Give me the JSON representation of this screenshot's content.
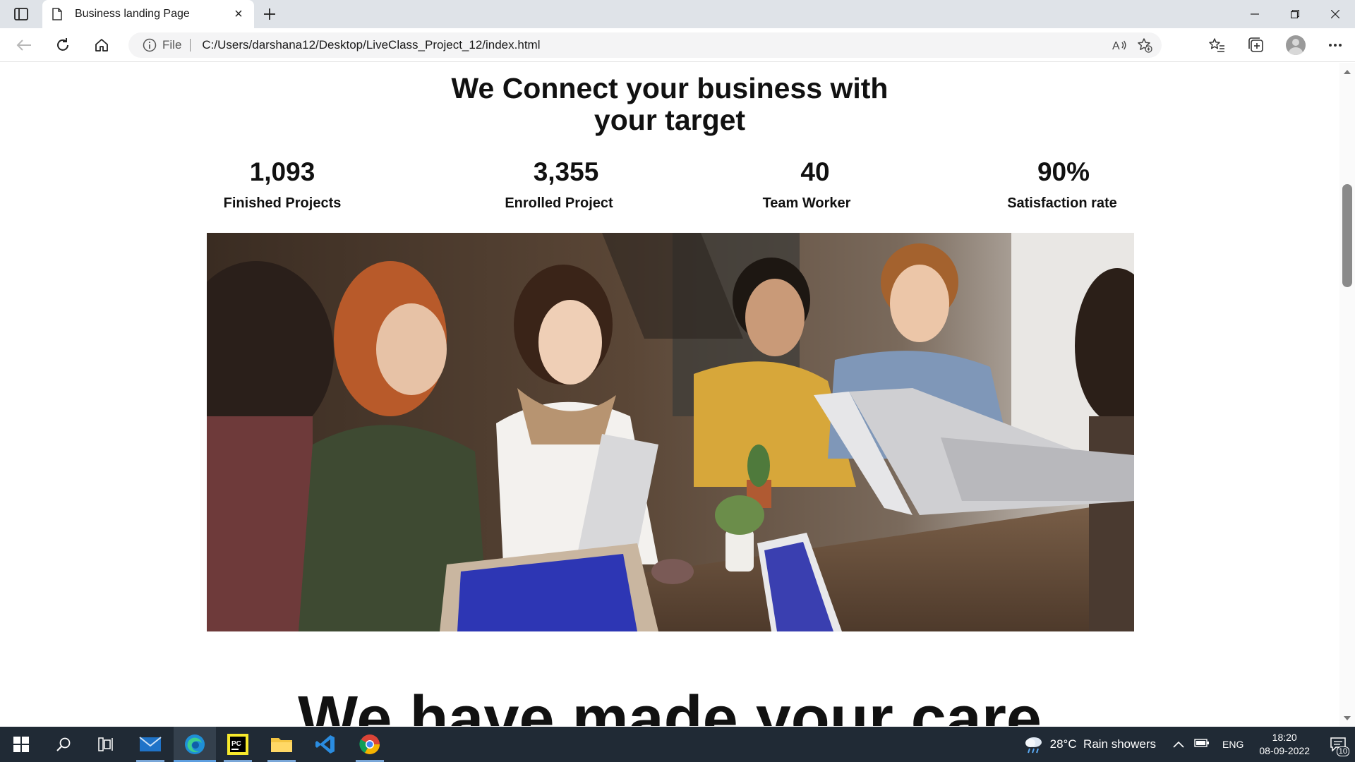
{
  "browser": {
    "tab_title": "Business landing Page",
    "tab_close": "×",
    "address_scheme_label": "File",
    "url": "C:/Users/darshana12/Desktop/LiveClass_Project_12/index.html"
  },
  "page": {
    "hero_title_line1": "We Connect your business with",
    "hero_title_line2": "your target",
    "stats": [
      {
        "value": "1,093",
        "label": "Finished Projects"
      },
      {
        "value": "3,355",
        "label": "Enrolled Project"
      },
      {
        "value": "40",
        "label": "Team Worker"
      },
      {
        "value": "90%",
        "label": "Satisfaction rate"
      }
    ],
    "next_heading": "We have made your care"
  },
  "taskbar": {
    "weather": "28°C  Rain showers",
    "language": "ENG",
    "time": "18:20",
    "date": "08-09-2022",
    "notification_count": "10",
    "apps": [
      "start-icon",
      "search-icon",
      "task-view-icon",
      "mail-icon",
      "edge-icon",
      "pycharm-icon",
      "file-explorer-icon",
      "vscode-icon",
      "chrome-icon"
    ]
  },
  "colors": {
    "taskbar_bg": "#202a35",
    "titlebar_bg": "#dfe3e8",
    "accent": "#0078d4"
  }
}
